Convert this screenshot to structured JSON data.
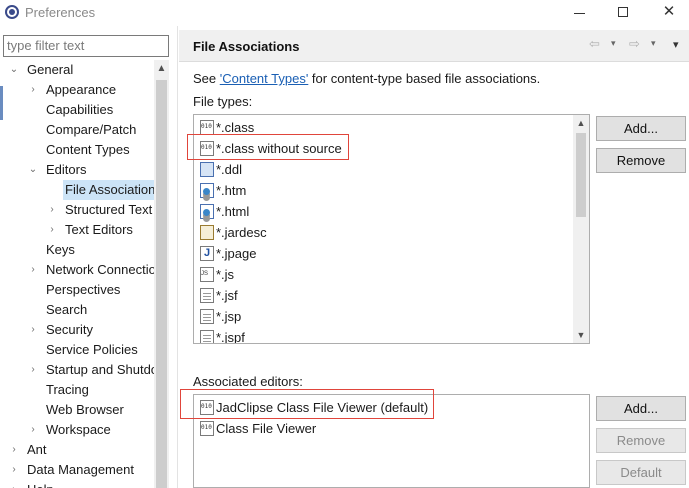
{
  "window": {
    "title": "Preferences",
    "minimize": "—",
    "maximize": "☐",
    "close": "✕"
  },
  "filter": {
    "placeholder": "type filter text"
  },
  "tree": {
    "items": [
      {
        "label": "General",
        "arrow": "⌄"
      },
      {
        "label": "Appearance",
        "arrow": "›"
      },
      {
        "label": "Capabilities",
        "arrow": ""
      },
      {
        "label": "Compare/Patch",
        "arrow": ""
      },
      {
        "label": "Content Types",
        "arrow": ""
      },
      {
        "label": "Editors",
        "arrow": "⌄"
      },
      {
        "label": "File Associations",
        "arrow": ""
      },
      {
        "label": "Structured Text Editors",
        "arrow": "›"
      },
      {
        "label": "Text Editors",
        "arrow": "›"
      },
      {
        "label": "Keys",
        "arrow": ""
      },
      {
        "label": "Network Connections",
        "arrow": "›"
      },
      {
        "label": "Perspectives",
        "arrow": ""
      },
      {
        "label": "Search",
        "arrow": ""
      },
      {
        "label": "Security",
        "arrow": "›"
      },
      {
        "label": "Service Policies",
        "arrow": ""
      },
      {
        "label": "Startup and Shutdown",
        "arrow": "›"
      },
      {
        "label": "Tracing",
        "arrow": ""
      },
      {
        "label": "Web Browser",
        "arrow": ""
      },
      {
        "label": "Workspace",
        "arrow": "›"
      },
      {
        "label": "Ant",
        "arrow": "›"
      },
      {
        "label": "Data Management",
        "arrow": "›"
      },
      {
        "label": "Help",
        "arrow": "›"
      }
    ],
    "scroll_up": "▲"
  },
  "page": {
    "title": "File Associations",
    "nav_back": "⇦",
    "nav_forward": "⇨",
    "dropdown": "▾",
    "menu": "▾",
    "see_prefix": "See ",
    "see_link": "'Content Types'",
    "see_suffix": " for content-type based file associations.",
    "file_types_label": "File types:",
    "associated_editors_label": "Associated editors:"
  },
  "file_types": [
    {
      "name": "*.class",
      "icon": "binary-class-icon"
    },
    {
      "name": "*.class without source",
      "icon": "binary-class-icon"
    },
    {
      "name": "*.ddl",
      "icon": "ddl-icon"
    },
    {
      "name": "*.htm",
      "icon": "web-page-icon"
    },
    {
      "name": "*.html",
      "icon": "web-page-icon"
    },
    {
      "name": "*.jardesc",
      "icon": "jar-descriptor-icon"
    },
    {
      "name": "*.jpage",
      "icon": "java-page-icon"
    },
    {
      "name": "*.js",
      "icon": "javascript-file-icon"
    },
    {
      "name": "*.jsf",
      "icon": "text-file-icon"
    },
    {
      "name": "*.jsp",
      "icon": "text-file-icon"
    },
    {
      "name": "*.jspf",
      "icon": "text-file-icon"
    }
  ],
  "editors": [
    {
      "name": "JadClipse Class File Viewer (default)",
      "icon": "jadclipse-icon"
    },
    {
      "name": "Class File Viewer",
      "icon": "class-viewer-icon"
    }
  ],
  "buttons": {
    "file_types_add": "Add...",
    "file_types_remove": "Remove",
    "editors_add": "Add...",
    "editors_remove": "Remove",
    "editors_default": "Default"
  },
  "scroll": {
    "up": "▲",
    "down": "▼"
  },
  "colors": {
    "highlight_box": "#e0453b",
    "selected_row": "#cce4f7",
    "link": "#1a5fb4"
  }
}
